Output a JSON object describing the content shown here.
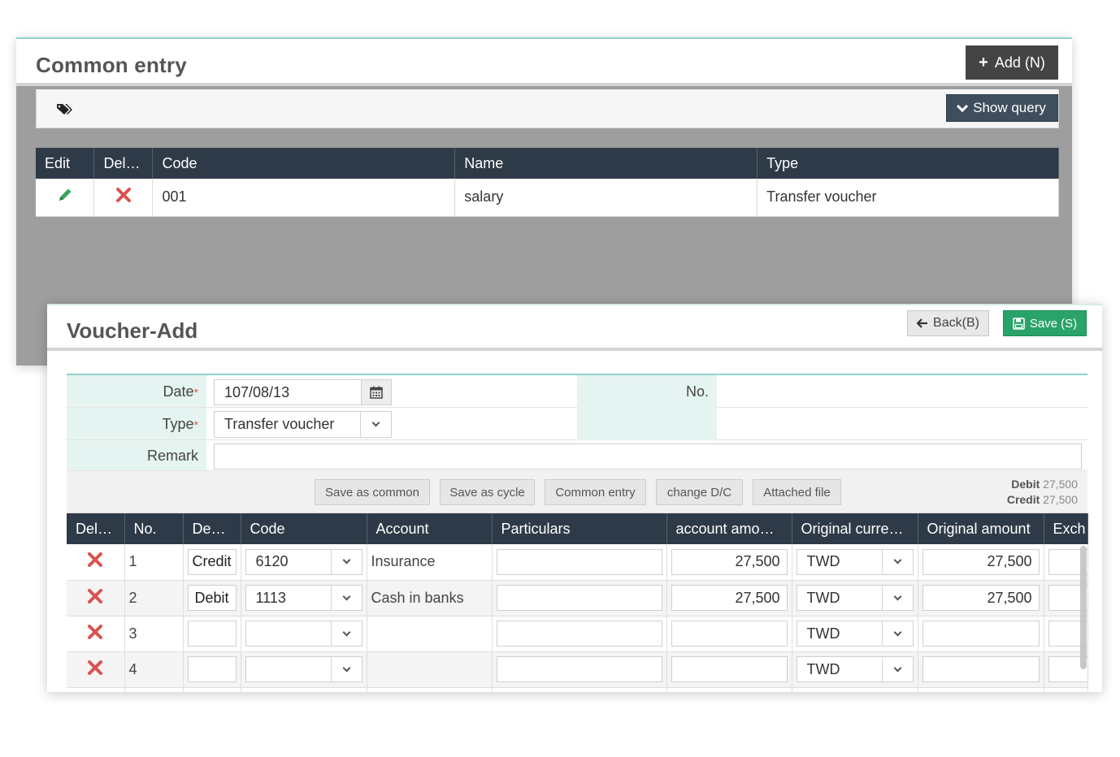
{
  "common_entry": {
    "title": "Common entry",
    "add_label": "Add (N)",
    "show_query_label": "Show query",
    "columns": [
      "Edit",
      "Del…",
      "Code",
      "Name",
      "Type"
    ],
    "rows": [
      {
        "code": "001",
        "name": "salary",
        "type": "Transfer voucher"
      }
    ]
  },
  "voucher": {
    "title": "Voucher-Add",
    "back_label": "Back(B)",
    "save_label": "Save (S)",
    "form": {
      "date_label": "Date",
      "date_value": "107/08/13",
      "type_label": "Type",
      "type_value": "Transfer voucher",
      "no_label": "No.",
      "remark_label": "Remark",
      "required_mark": "*"
    },
    "actions": [
      "Save as common",
      "Save as cycle",
      "Common entry",
      "change D/C",
      "Attached file"
    ],
    "totals": {
      "debit_label": "Debit",
      "debit_value": "27,500",
      "credit_label": "Credit",
      "credit_value": "27,500"
    },
    "columns": [
      "Del…",
      "No.",
      "De…",
      "Code",
      "Account",
      "Particulars",
      "account amo…",
      "Original curre…",
      "Original amount",
      "Exch"
    ],
    "rows": [
      {
        "no": "1",
        "dc": "Credit",
        "code": "6120",
        "account": "Insurance",
        "account_amount": "27,500",
        "currency": "TWD",
        "original_amount": "27,500"
      },
      {
        "no": "2",
        "dc": "Debit",
        "code": "1113",
        "account": "Cash in banks",
        "account_amount": "27,500",
        "currency": "TWD",
        "original_amount": "27,500"
      },
      {
        "no": "3",
        "dc": "",
        "code": "",
        "account": "",
        "account_amount": "",
        "currency": "TWD",
        "original_amount": ""
      },
      {
        "no": "4",
        "dc": "",
        "code": "",
        "account": "",
        "account_amount": "",
        "currency": "TWD",
        "original_amount": ""
      }
    ]
  },
  "colors": {
    "header_dark": "#2e3a47",
    "save_green": "#29a36a",
    "delete_red": "#d9534f",
    "edit_green": "#3aa35f",
    "label_tint": "#e6f4f1"
  }
}
